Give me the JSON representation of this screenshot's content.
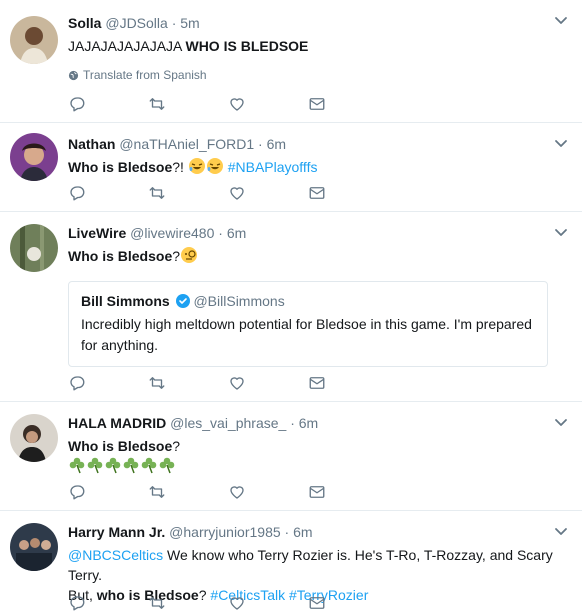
{
  "tweets": [
    {
      "name": "Solla",
      "handle": "@JDSolla",
      "time": "5m",
      "text_plain": "JAJAJAJAJAJAJA ",
      "text_bold": "WHO IS BLEDSOE",
      "translate": "Translate from Spanish"
    },
    {
      "name": "Nathan",
      "handle": "@naTHAniel_FORD1",
      "time": "6m",
      "text_bold": "Who is Bledsoe",
      "text_plain": "?! ",
      "hashtag": "#NBAPlayofffs",
      "emoji": "rofl-emoji"
    },
    {
      "name": "LiveWire",
      "handle": "@livewire480",
      "time": "6m",
      "text_bold": "Who is Bledsoe",
      "text_plain": "?",
      "emoji": "monocle-emoji",
      "quote": {
        "name": "Bill Simmons",
        "handle": "@BillSimmons",
        "text": "Incredibly high meltdown potential for Bledsoe in this game. I'm prepared for anything."
      }
    },
    {
      "name": "HALA MADRID",
      "handle": "@les_vai_phrase_",
      "time": "6m",
      "text_bold": "Who is Bledsoe",
      "text_plain": "?",
      "emoji": "shamrock-emoji"
    },
    {
      "name": "Harry Mann Jr.",
      "handle": "@harryjunior1985",
      "time": "6m",
      "mention": "@NBCSCeltics",
      "text_1": " We know who Terry Rozier is. He's T-Ro, T-Rozzay, and Scary Terry.",
      "text_2": "But, ",
      "text_bold": "who is Bledsoe",
      "text_3": "? ",
      "hashtag1": "#CelticsTalk",
      "hashtag2": "#TerryRozier"
    }
  ],
  "dot": "·",
  "colors": {
    "link": "#1da1f2",
    "muted": "#657786",
    "border": "#e6ecf0",
    "verified": "#1da1f2"
  }
}
